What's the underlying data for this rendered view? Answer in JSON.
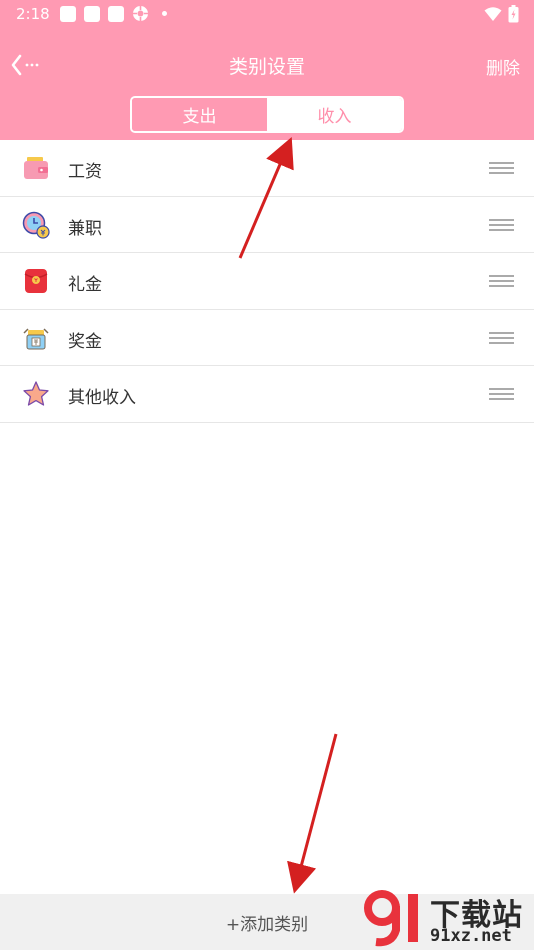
{
  "status_bar": {
    "time": "2:18"
  },
  "header": {
    "title": "类别设置",
    "delete_label": "删除",
    "back_icon": "back-ellipsis-icon"
  },
  "tabs": [
    {
      "label": "支出",
      "selected": false
    },
    {
      "label": "收入",
      "selected": true
    }
  ],
  "categories": [
    {
      "label": "工资",
      "icon": "wallet-icon"
    },
    {
      "label": "兼职",
      "icon": "clock-coin-icon"
    },
    {
      "label": "礼金",
      "icon": "red-envelope-icon"
    },
    {
      "label": "奖金",
      "icon": "bonus-robot-icon"
    },
    {
      "label": "其他收入",
      "icon": "star-icon"
    }
  ],
  "add_category_label": "+添加类别",
  "watermark": {
    "text": "下载站",
    "url": "91xz.net"
  },
  "colors": {
    "brand_pink": "#ff9ab3",
    "income_text": "#ff8fab",
    "arrow_red": "#d42020"
  }
}
